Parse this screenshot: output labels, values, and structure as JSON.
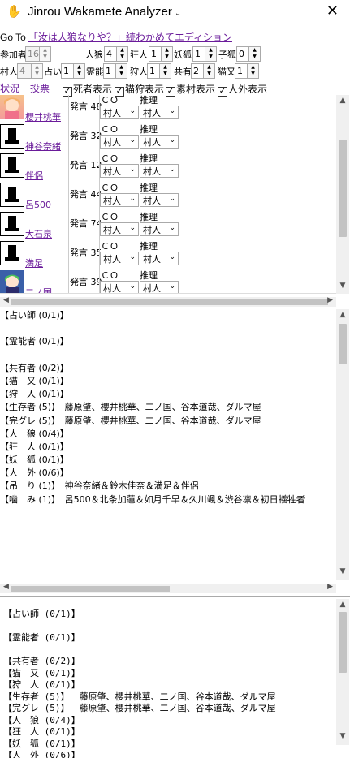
{
  "window": {
    "icon": "hand-icon",
    "title": "Jinrou Wakamete Analyzer",
    "chevron": "⌄",
    "close": "✕"
  },
  "goto": {
    "label": "Go To",
    "link": "「汝は人狼なりや？」続わかめてエディション"
  },
  "config_row1": [
    {
      "label": "参加者",
      "value": "16",
      "disabled": true
    },
    {
      "label": "人狼",
      "value": "4"
    },
    {
      "label": "狂人",
      "value": "1"
    },
    {
      "label": "妖狐",
      "value": "1"
    },
    {
      "label": "子狐",
      "value": "0"
    }
  ],
  "config_row2": [
    {
      "label": "村人",
      "value": "4",
      "disabled": true
    },
    {
      "label": "占い",
      "value": "1"
    },
    {
      "label": "霊能",
      "value": "1"
    },
    {
      "label": "狩人",
      "value": "1"
    },
    {
      "label": "共有",
      "value": "2"
    },
    {
      "label": "猫又",
      "value": "1"
    }
  ],
  "tabs": {
    "status": "状況",
    "vote": "投票"
  },
  "toggles": [
    {
      "label": "死者表示",
      "checked": true
    },
    {
      "label": "猫狩表示",
      "checked": true
    },
    {
      "label": "素村表示",
      "checked": true
    },
    {
      "label": "人外表示",
      "checked": true
    }
  ],
  "players": [
    {
      "name": "櫻井桃華",
      "count": "発言 48",
      "co": "村人",
      "guess": "村人",
      "avatar": "pink"
    },
    {
      "name": "神谷奈緒",
      "count": "発言 32",
      "co": "村人",
      "guess": "村人",
      "avatar": "dead"
    },
    {
      "name": "伴侶",
      "count": "発言 12",
      "co": "村人",
      "guess": "村人",
      "avatar": "dead"
    },
    {
      "name": "呂500",
      "count": "発言 44",
      "co": "村人",
      "guess": "村人",
      "avatar": "dead"
    },
    {
      "name": "大石泉",
      "count": "発言 74",
      "co": "村人",
      "guess": "村人",
      "avatar": "dead"
    },
    {
      "name": "満足",
      "count": "発言 35",
      "co": "村人",
      "guess": "村人",
      "avatar": "dead"
    },
    {
      "name": "二ノ国",
      "count": "発言 39",
      "co": "村人",
      "guess": "村人",
      "avatar": "green"
    }
  ],
  "col_labels": {
    "co": "ＣＯ",
    "guess": "推理"
  },
  "summary_lines": [
    "【占い師 (0/1)】",
    "",
    "【霊能者 (0/1)】",
    "",
    "【共有者 (0/2)】",
    "【猫　又 (0/1)】",
    "【狩　人 (0/1)】",
    "【生存者 (5)】　藤原肇、櫻井桃華、二ノ国、谷本道哉、ダルマ屋",
    "【完グレ (5)】　藤原肇、櫻井桃華、二ノ国、谷本道哉、ダルマ屋",
    "【人　狼 (0/4)】",
    "【狂　人 (0/1)】",
    "【妖　狐 (0/1)】",
    "【人　外 (0/6)】",
    "【吊　り (1)】　神谷奈緒＆鈴木佳奈＆満足＆伴侶",
    "【噛　み (1)】　呂500＆北条加蓮＆如月千早＆久川颯＆渋谷凛＆初日犠牲者"
  ],
  "text_lines": [
    "【占い師 (0/1)】",
    "",
    "【霊能者 (0/1)】",
    "",
    "【共有者 (0/2)】",
    "【猫　又 (0/1)】",
    "【狩　人 (0/1)】",
    "【生存者 (5)】　 藤原肇、櫻井桃華、二ノ国、谷本道哉、ダルマ屋",
    "【完グレ (5)】　 藤原肇、櫻井桃華、二ノ国、谷本道哉、ダルマ屋",
    "【人　狼 (0/4)】",
    "【狂　人 (0/1)】",
    "【妖　狐 (0/1)】",
    "【人　外 (0/6)】"
  ]
}
